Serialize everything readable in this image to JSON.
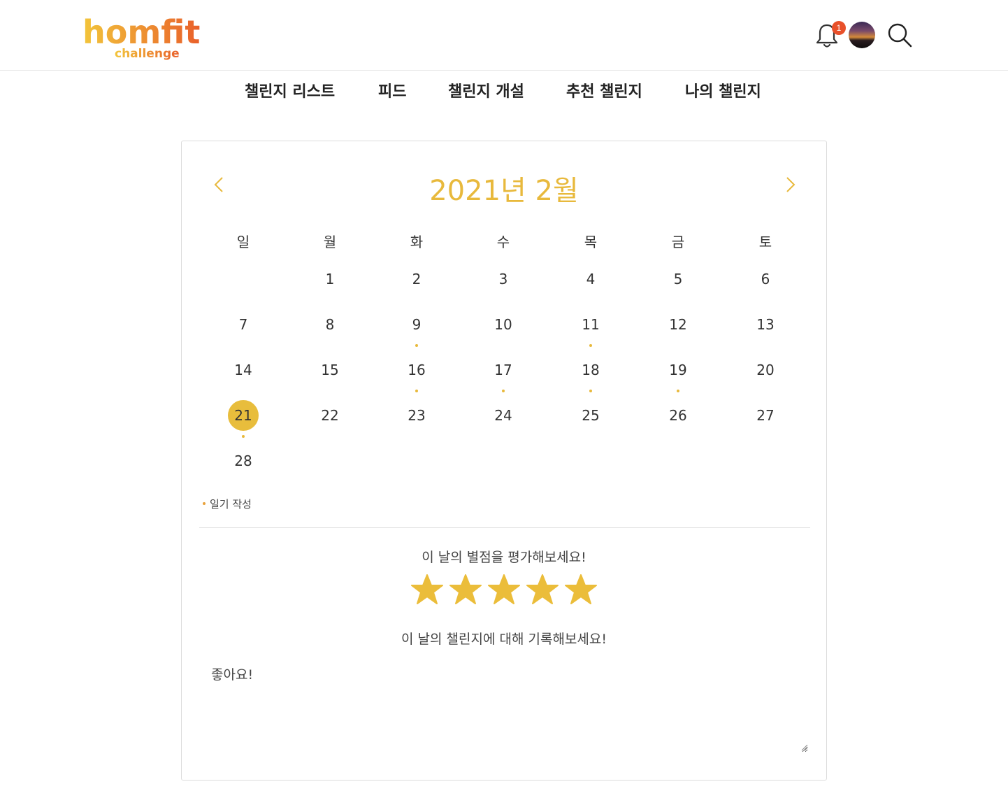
{
  "header": {
    "logo_main": "homfit",
    "logo_sub": "challenge",
    "notification_count": "1",
    "brand_gradient": [
      "#f2c53b",
      "#e9602a"
    ],
    "badge_color": "#e8502a"
  },
  "nav": {
    "items": [
      {
        "label": "챌린지 리스트"
      },
      {
        "label": "피드"
      },
      {
        "label": "챌린지 개설"
      },
      {
        "label": "추천 챌린지"
      },
      {
        "label": "나의 챌린지"
      }
    ]
  },
  "calendar": {
    "title": "2021년 2월",
    "accent_color": "#e8b93c",
    "weekdays": [
      "일",
      "월",
      "화",
      "수",
      "목",
      "금",
      "토"
    ],
    "selected_day": "21",
    "weeks": [
      [
        "",
        "1",
        "2",
        "3",
        "4",
        "5",
        "6"
      ],
      [
        "7",
        "8",
        "9",
        "10",
        "11",
        "12",
        "13"
      ],
      [
        "14",
        "15",
        "16",
        "17",
        "18",
        "19",
        "20"
      ],
      [
        "21",
        "22",
        "23",
        "24",
        "25",
        "26",
        "27"
      ],
      [
        "28",
        "",
        "",
        "",
        "",
        "",
        ""
      ]
    ],
    "diary_days": [
      "9",
      "11",
      "16",
      "17",
      "18",
      "19",
      "21"
    ],
    "legend_label": "일기 작성"
  },
  "rating": {
    "prompt": "이 날의 별점을 평가해보세요!",
    "value": 5,
    "max": 5,
    "star_color": "#ebbd3a"
  },
  "record": {
    "prompt": "이 날의 챌린지에 대해 기록해보세요!",
    "value": "좋아요!"
  }
}
